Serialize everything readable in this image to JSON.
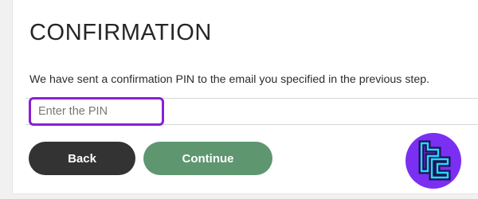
{
  "confirmation": {
    "title": "CONFIRMATION",
    "message": "We have sent a confirmation PIN to the email you specified in the previous step.",
    "pin_input": {
      "value": "",
      "placeholder": "Enter the PIN"
    },
    "back_label": "Back",
    "continue_label": "Continue"
  },
  "logo": {
    "icon": "tc-logo-icon",
    "background": "#7b2ff2",
    "glyph_color": "#27d6ff"
  },
  "colors": {
    "accent_focus": "#8a1fd6",
    "back_button": "#333333",
    "continue_button": "#5e9670",
    "page_background": "#f1f1f1"
  }
}
